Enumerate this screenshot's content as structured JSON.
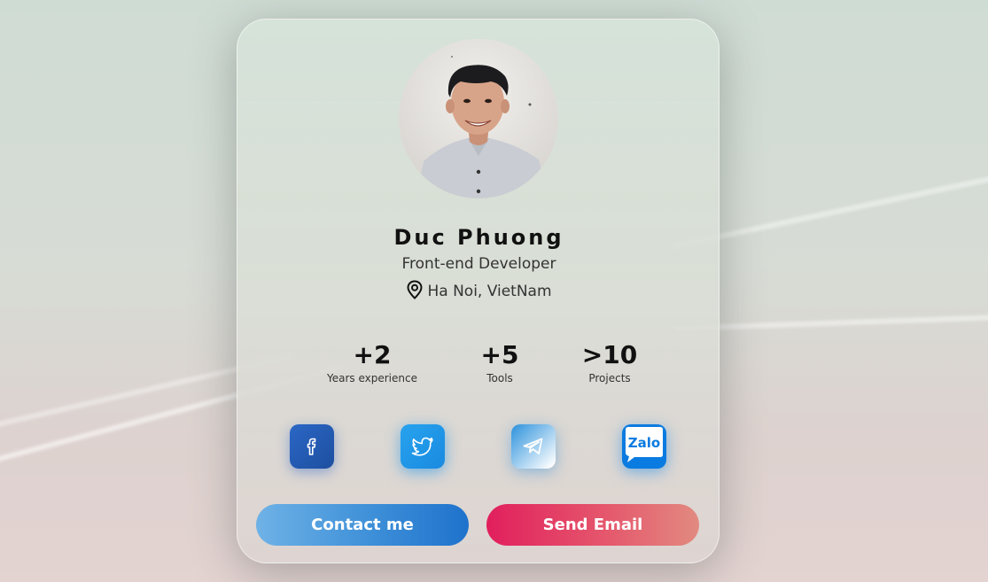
{
  "profile": {
    "name": "Duc Phuong",
    "role": "Front-end Developer",
    "location": "Ha Noi, VietNam"
  },
  "stats": [
    {
      "value": "+2",
      "label": "Years experience"
    },
    {
      "value": "+5",
      "label": "Tools"
    },
    {
      "value": ">10",
      "label": "Projects"
    }
  ],
  "social": {
    "items": [
      {
        "icon": "facebook-icon"
      },
      {
        "icon": "twitter-icon"
      },
      {
        "icon": "telegram-icon"
      },
      {
        "icon": "zalo-icon",
        "label": "Zalo"
      }
    ]
  },
  "actions": {
    "contact_label": "Contact me",
    "email_label": "Send Email"
  },
  "colors": {
    "facebook": "#2b67c6",
    "twitter": "#1da1f2",
    "telegram": "#2c92dc",
    "zalo": "#0a7be0",
    "contact_button": "#3d8fd8",
    "email_button": "#e11f5d"
  }
}
